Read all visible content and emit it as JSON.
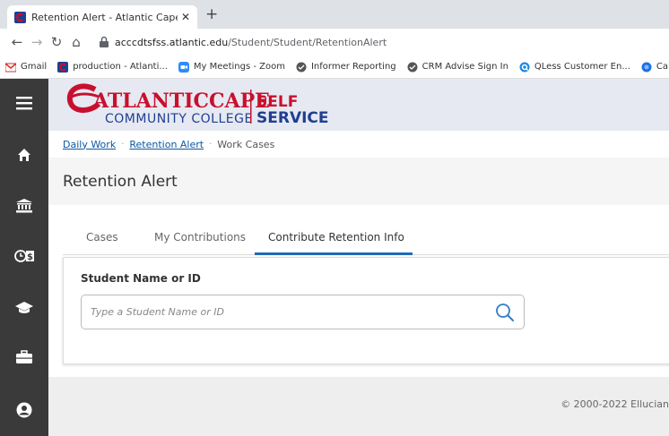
{
  "browser": {
    "tab_title": "Retention Alert - Atlantic Cape S",
    "tab_close": "✕",
    "new_tab": "+",
    "url_host": "acccdtsfss.atlantic.edu",
    "url_path": "/Student/Student/RetentionAlert",
    "bookmarks": [
      {
        "label": "Gmail"
      },
      {
        "label": "production - Atlanti..."
      },
      {
        "label": "My Meetings - Zoom"
      },
      {
        "label": "Informer Reporting"
      },
      {
        "label": "CRM Advise Sign In"
      },
      {
        "label": "QLess Customer En..."
      },
      {
        "label": "Cal"
      }
    ]
  },
  "logo": {
    "name_line1": "ATLANTICCAPE",
    "name_line2": "COMMUNITY COLLEGE",
    "self": "SELF",
    "service": "SERVICE"
  },
  "breadcrumbs": {
    "items": [
      "Daily Work",
      "Retention Alert"
    ],
    "current": "Work Cases",
    "separator": "·"
  },
  "page": {
    "title": "Retention Alert"
  },
  "tabs": [
    {
      "label": "Cases"
    },
    {
      "label": "My Contributions"
    },
    {
      "label": "Contribute Retention Info",
      "active": true
    }
  ],
  "form": {
    "label": "Student Name or ID",
    "placeholder": "Type a Student Name or ID",
    "value": ""
  },
  "footer": {
    "copyright": "© 2000-2022 Ellucian"
  },
  "colors": {
    "sidebar": "#3a3a3a",
    "header": "#e6e9f2",
    "brand_red": "#c8102e",
    "brand_blue": "#1f3f8f",
    "active_tab": "#1f6ab8"
  }
}
